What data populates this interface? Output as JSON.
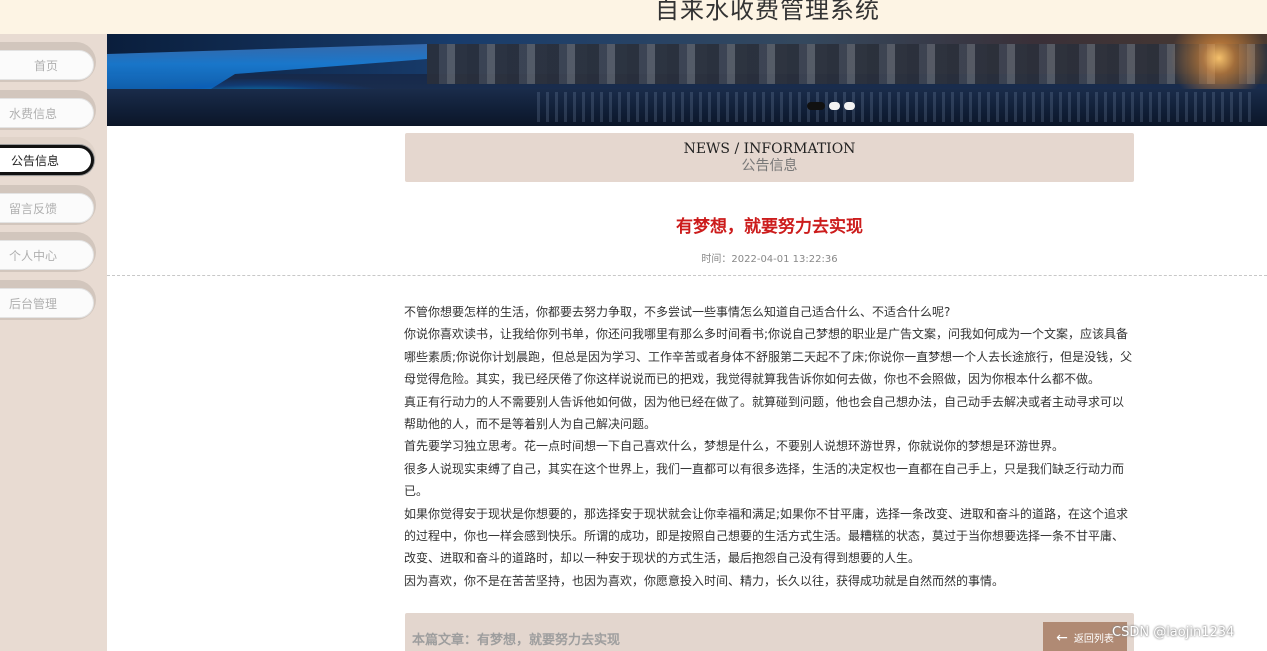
{
  "site": {
    "title": "自来水收费管理系统"
  },
  "sidebar": {
    "items": [
      {
        "label": "首页",
        "active": false
      },
      {
        "label": "水费信息",
        "active": false
      },
      {
        "label": "公告信息",
        "active": true
      },
      {
        "label": "留言反馈",
        "active": false
      },
      {
        "label": "个人中心",
        "active": false
      },
      {
        "label": "后台管理",
        "active": false
      }
    ]
  },
  "banner": {
    "slide_count": 3,
    "active_slide": 1
  },
  "section": {
    "en": "NEWS / INFORMATION",
    "cn": "公告信息"
  },
  "article": {
    "title": "有梦想，就要努力去实现",
    "time": "时间：2022-04-01 13:22:36",
    "paragraphs": [
      "不管你想要怎样的生活，你都要去努力争取，不多尝试一些事情怎么知道自己适合什么、不适合什么呢?",
      "你说你喜欢读书，让我给你列书单，你还问我哪里有那么多时间看书;你说自己梦想的职业是广告文案，问我如何成为一个文案，应该具备哪些素质;你说你计划晨跑，但总是因为学习、工作辛苦或者身体不舒服第二天起不了床;你说你一直梦想一个人去长途旅行，但是没钱，父母觉得危险。其实，我已经厌倦了你这样说说而已的把戏，我觉得就算我告诉你如何去做，你也不会照做，因为你根本什么都不做。",
      "真正有行动力的人不需要别人告诉他如何做，因为他已经在做了。就算碰到问题，他也会自己想办法，自己动手去解决或者主动寻求可以帮助他的人，而不是等着别人为自己解决问题。",
      "首先要学习独立思考。花一点时间想一下自己喜欢什么，梦想是什么，不要别人说想环游世界，你就说你的梦想是环游世界。",
      "很多人说现实束缚了自己，其实在这个世界上，我们一直都可以有很多选择，生活的决定权也一直都在自己手上，只是我们缺乏行动力而已。",
      "如果你觉得安于现状是你想要的，那选择安于现状就会让你幸福和满足;如果你不甘平庸，选择一条改变、进取和奋斗的道路，在这个追求的过程中，你也一样会感到快乐。所谓的成功，即是按照自己想要的生活方式生活。最糟糕的状态，莫过于当你想要选择一条不甘平庸、改变、进取和奋斗的道路时，却以一种安于现状的方式生活，最后抱怨自己没有得到想要的人生。",
      "因为喜欢，你不是在苦苦坚持，也因为喜欢，你愿意投入时间、精力，长久以往，获得成功就是自然而然的事情。"
    ]
  },
  "footer": {
    "current_label": "本篇文章：有梦想，就要努力去实现",
    "back_label": "返回列表"
  },
  "watermark": "CSDN @laojin1234",
  "colors": {
    "header_bg": "#fdf4e4",
    "sidebar_bg": "#e8dbd2",
    "section_bar_bg": "#e5d7cf",
    "title_red": "#cc1c1c",
    "back_button_bg": "#b08a74"
  }
}
